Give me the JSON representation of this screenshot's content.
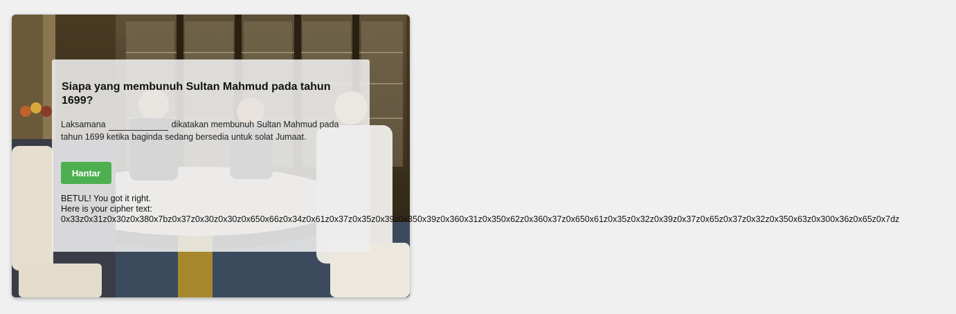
{
  "quiz": {
    "question": "Siapa yang membunuh Sultan Mahmud pada tahun 1699?",
    "sentence_before": "Laksamana",
    "sentence_after": "dikatakan membunuh Sultan Mahmud pada tahun 1699 ketika baginda sedang bersedia untuk solat Jumaat.",
    "answer_value": "",
    "submit_label": "Hantar"
  },
  "result": {
    "status": "BETUL! You got it right.",
    "cipher_label": "Here is your cipher text:",
    "cipher_text": "0x33z0x31z0x30z0x380x7bz0x37z0x30z0x30z0x650x66z0x34z0x61z0x37z0x35z0x39z0x350x39z0x360x31z0x350x62z0x360x37z0x650x61z0x35z0x32z0x39z0x37z0x65z0x37z0x32z0x350x63z0x300x36z0x65z0x7dz"
  },
  "colors": {
    "page_bg": "#f0f0f0",
    "button_bg": "#4caf50",
    "button_text": "#ffffff"
  },
  "background_image": "photo of a royal dining room with men seated around a table, display cabinets behind"
}
